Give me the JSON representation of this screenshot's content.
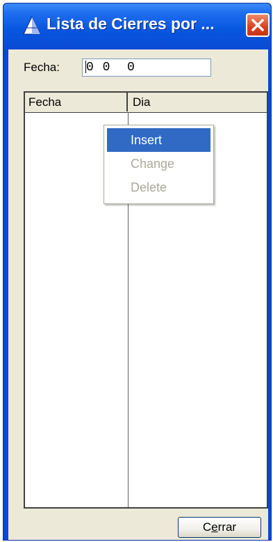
{
  "window": {
    "title": "Lista de Cierres por ...",
    "app_icon": "pyramid-icon",
    "close_icon": "close-icon"
  },
  "filter": {
    "label": "Fecha:",
    "value": "0 0  0"
  },
  "list": {
    "columns": [
      "Fecha",
      "Dia"
    ],
    "rows": []
  },
  "context_menu": {
    "items": [
      {
        "label": "Insert",
        "state": "selected"
      },
      {
        "label": "Change",
        "state": "disabled"
      },
      {
        "label": "Delete",
        "state": "disabled"
      }
    ]
  },
  "footer": {
    "close_button_prefix": "C",
    "close_button_mnemonic": "e",
    "close_button_suffix": "rrar"
  },
  "colors": {
    "titlebar": "#0a4ad3",
    "selection": "#316ac5",
    "close_button": "#d8411e",
    "dialog_face": "#ece9d8"
  }
}
